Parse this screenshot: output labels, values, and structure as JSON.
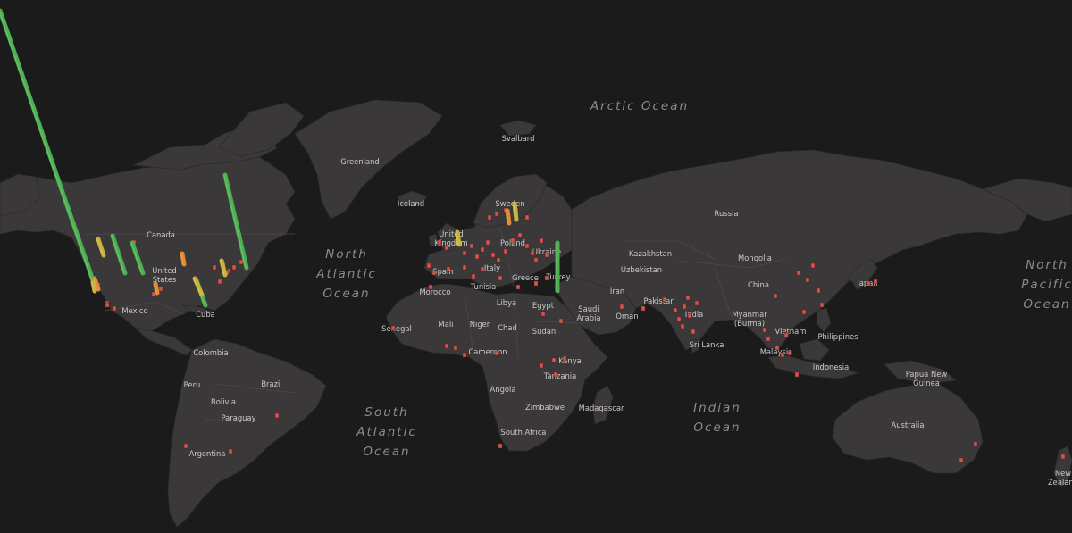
{
  "map": {
    "ocean_labels": [
      {
        "id": "arctic",
        "lines": [
          "Arctic Ocean"
        ]
      },
      {
        "id": "north-atlantic",
        "lines": [
          "North",
          "Atlantic",
          "Ocean"
        ]
      },
      {
        "id": "south-atlantic",
        "lines": [
          "South",
          "Atlantic",
          "Ocean"
        ]
      },
      {
        "id": "indian",
        "lines": [
          "Indian",
          "Ocean"
        ]
      },
      {
        "id": "north-pacific",
        "lines": [
          "North",
          "Pacific",
          "Ocean"
        ]
      }
    ],
    "country_labels": [
      {
        "id": "greenland",
        "text": "Greenland"
      },
      {
        "id": "svalbard",
        "text": "Svalbard"
      },
      {
        "id": "iceland",
        "text": "Iceland"
      },
      {
        "id": "canada",
        "text": "Canada"
      },
      {
        "id": "united-states",
        "text": "United States"
      },
      {
        "id": "mexico",
        "text": "Mexico"
      },
      {
        "id": "cuba",
        "text": "Cuba"
      },
      {
        "id": "colombia",
        "text": "Colombia"
      },
      {
        "id": "peru",
        "text": "Peru"
      },
      {
        "id": "brazil",
        "text": "Brazil"
      },
      {
        "id": "bolivia",
        "text": "Bolivia"
      },
      {
        "id": "paraguay",
        "text": "Paraguay"
      },
      {
        "id": "argentina",
        "text": "Argentina"
      },
      {
        "id": "sweden",
        "text": "Sweden"
      },
      {
        "id": "united-kingdom",
        "text": "United Kingdom"
      },
      {
        "id": "poland",
        "text": "Poland"
      },
      {
        "id": "ukraine",
        "text": "Ukraine"
      },
      {
        "id": "spain",
        "text": "Spain"
      },
      {
        "id": "italy",
        "text": "Italy"
      },
      {
        "id": "greece",
        "text": "Greece"
      },
      {
        "id": "turkey",
        "text": "Turkey"
      },
      {
        "id": "morocco",
        "text": "Morocco"
      },
      {
        "id": "tunisia",
        "text": "Tunisia"
      },
      {
        "id": "libya",
        "text": "Libya"
      },
      {
        "id": "egypt",
        "text": "Egypt"
      },
      {
        "id": "mali",
        "text": "Mali"
      },
      {
        "id": "niger",
        "text": "Niger"
      },
      {
        "id": "chad",
        "text": "Chad"
      },
      {
        "id": "sudan",
        "text": "Sudan"
      },
      {
        "id": "senegal",
        "text": "Senegal"
      },
      {
        "id": "cameroon",
        "text": "Cameroon"
      },
      {
        "id": "kenya",
        "text": "Kenya"
      },
      {
        "id": "tanzania",
        "text": "Tanzania"
      },
      {
        "id": "angola",
        "text": "Angola"
      },
      {
        "id": "zimbabwe",
        "text": "Zimbabwe"
      },
      {
        "id": "madagascar",
        "text": "Madagascar"
      },
      {
        "id": "south-africa",
        "text": "South Africa"
      },
      {
        "id": "russia",
        "text": "Russia"
      },
      {
        "id": "kazakhstan",
        "text": "Kazakhstan"
      },
      {
        "id": "uzbekistan",
        "text": "Uzbekistan"
      },
      {
        "id": "mongolia",
        "text": "Mongolia"
      },
      {
        "id": "china",
        "text": "China"
      },
      {
        "id": "japan",
        "text": "Japan"
      },
      {
        "id": "iran",
        "text": "Iran"
      },
      {
        "id": "saudi-arabia",
        "text": "Saudi Arabia"
      },
      {
        "id": "oman",
        "text": "Oman"
      },
      {
        "id": "pakistan",
        "text": "Pakistan"
      },
      {
        "id": "india",
        "text": "India"
      },
      {
        "id": "myanmar",
        "text": "Myanmar (Burma)"
      },
      {
        "id": "sri-lanka",
        "text": "Sri Lanka"
      },
      {
        "id": "vietnam",
        "text": "Vietnam"
      },
      {
        "id": "philippines",
        "text": "Philippines"
      },
      {
        "id": "malaysia",
        "text": "Malaysia"
      },
      {
        "id": "indonesia",
        "text": "Indonesia"
      },
      {
        "id": "papua-new-guinea",
        "text": "Papua New Guinea"
      },
      {
        "id": "australia",
        "text": "Australia"
      },
      {
        "id": "new-zealand",
        "text": "New Zealand"
      }
    ],
    "colors": {
      "background": "#1b1b1b",
      "land": "#3a3838",
      "bar_high": "#4caf50",
      "bar_mid": "#c8b23c",
      "bar_low": "#e08a3a",
      "marker": "#d9534f"
    }
  }
}
